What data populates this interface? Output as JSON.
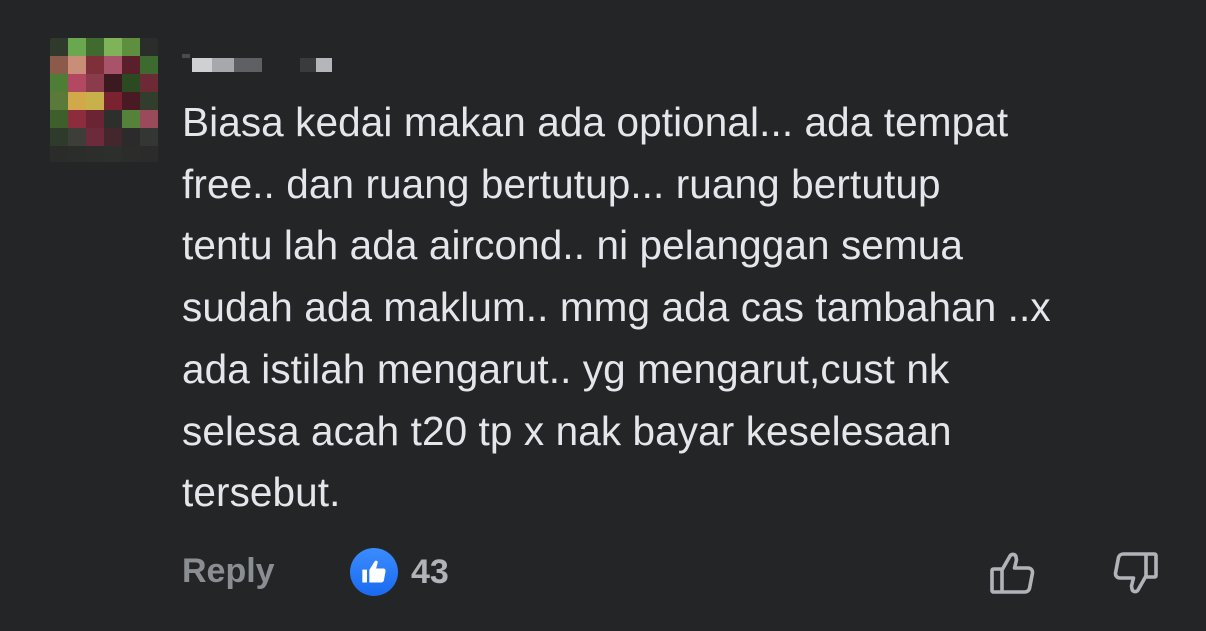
{
  "comment": {
    "author_redacted": true,
    "text": "Biasa kedai makan ada optional... ada tempat\nfree.. dan ruang bertutup... ruang bertutup\ntentu lah ada aircond.. ni pelanggan semua\nsudah ada maklum.. mmg ada cas tambahan ..x\nada istilah mengarut.. yg mengarut,cust nk\nselesa acah t20 tp x nak bayar keselesaan\ntersebut."
  },
  "actions": {
    "reply_label": "Reply",
    "reaction_icon": "like-icon",
    "reaction_count": "43",
    "upvote_icon": "thumbs-up-outline-icon",
    "downvote_icon": "thumbs-down-outline-icon"
  },
  "colors": {
    "background": "#242526",
    "text": "#e4e6eb",
    "secondary_text": "#8a8d91",
    "like_blue": "#1877f2"
  }
}
